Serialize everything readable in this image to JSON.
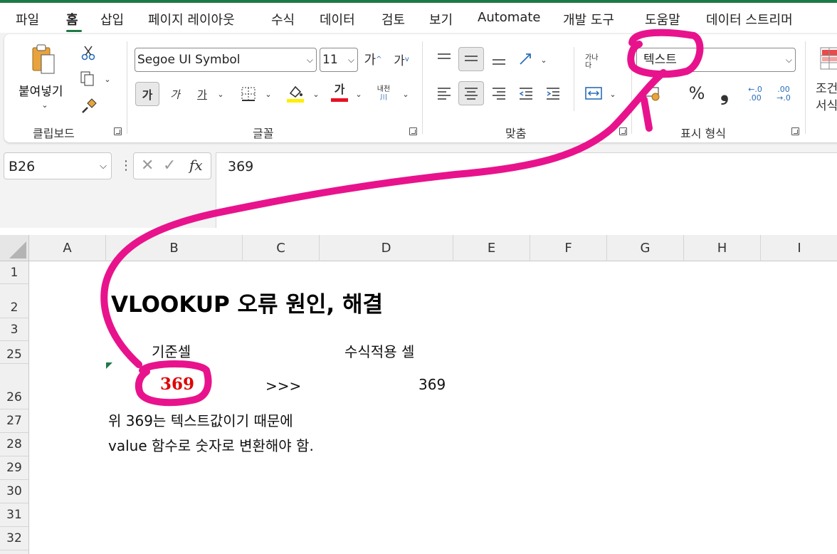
{
  "menu": {
    "items": [
      "파일",
      "홈",
      "삽입",
      "페이지 레이아웃",
      "수식",
      "데이터",
      "검토",
      "보기",
      "Automate",
      "개발 도구",
      "도움말",
      "데이터 스트리머"
    ]
  },
  "ribbon": {
    "clipboard": {
      "paste_label": "붙여넣기",
      "group_label": "클립보드"
    },
    "font": {
      "font_name": "Segoe UI Symbol",
      "font_size": "11",
      "grow_glyph": "가",
      "shrink_glyph": "가",
      "bold_glyph": "가",
      "italic_glyph": "가",
      "underline_glyph": "가",
      "fontcolor_glyph": "가",
      "phonetic_glyph": "내천",
      "group_label": "글꼴",
      "highlight_color": "#ffee00",
      "font_color": "#e81123"
    },
    "alignment": {
      "wrap_glyph": "가나다",
      "group_label": "맞춤"
    },
    "number": {
      "format_value": "텍스트",
      "percent_glyph": "%",
      "comma_glyph": "❟",
      "inc_decimal": "←.0 .00",
      "dec_decimal": ".00 →.0",
      "group_label": "표시 형식"
    },
    "styles": {
      "cond_label_1": "조건",
      "cond_label_2": "서식"
    }
  },
  "formula_bar": {
    "name_box": "B26",
    "cancel_glyph": "✕",
    "enter_glyph": "✓",
    "fx_glyph": "fx",
    "content": "369"
  },
  "sheet": {
    "columns": [
      "A",
      "B",
      "C",
      "D",
      "E",
      "F",
      "G",
      "H",
      "I"
    ],
    "rows": [
      "1",
      "2",
      "3",
      "25",
      "26",
      "27",
      "28",
      "29",
      "30",
      "31",
      "32"
    ],
    "cells": {
      "title": "VLOOKUP 오류 원인, 해결",
      "b25": "기준셀",
      "d25": "수식적용 셀",
      "b26": "369",
      "c26": ">>>",
      "d26": "369",
      "b27": "위 369는 텍스트값이기 때문에",
      "b28": "value 함수로 숫자로 변환해야 함."
    },
    "b26_color": "#e00000",
    "error_indicator_color": "#1e7a45"
  },
  "annotation": {
    "color": "#e8138c"
  }
}
